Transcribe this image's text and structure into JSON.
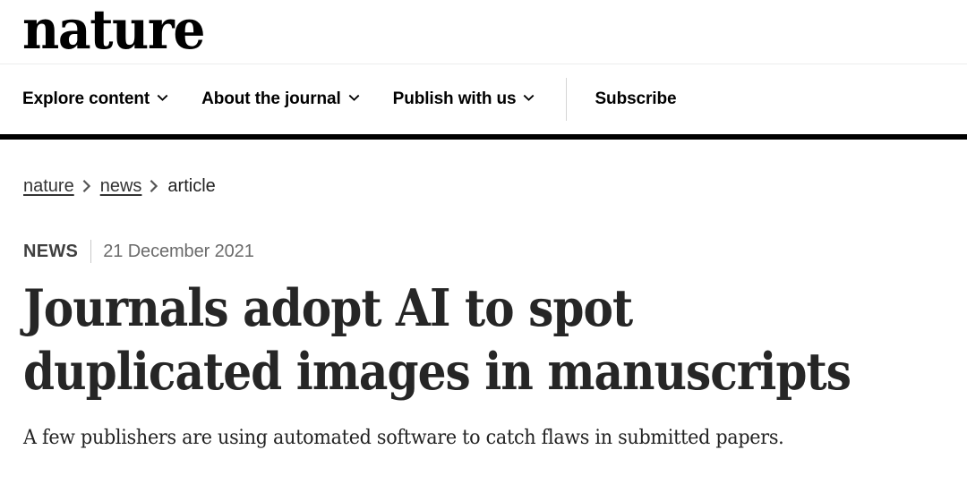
{
  "site": {
    "logo_text": "nature"
  },
  "nav": {
    "items": [
      {
        "label": "Explore content",
        "has_chevron": true,
        "icon": "chevron-down-icon"
      },
      {
        "label": "About the journal",
        "has_chevron": true,
        "icon": "chevron-down-icon"
      },
      {
        "label": "Publish with us",
        "has_chevron": true,
        "icon": "chevron-down-icon"
      },
      {
        "label": "Subscribe",
        "has_chevron": false,
        "icon": ""
      }
    ]
  },
  "breadcrumb": {
    "separator_icon": "chevron-right-icon",
    "items": [
      {
        "label": "nature",
        "is_link": true
      },
      {
        "label": "news",
        "is_link": true
      },
      {
        "label": "article",
        "is_link": false
      }
    ]
  },
  "article": {
    "kicker": "NEWS",
    "date": "21 December 2021",
    "title_line_1": "Journals adopt AI to spot",
    "title_line_2": "duplicated images in manuscripts",
    "standfirst": "A few publishers are using automated software to catch flaws in submitted papers."
  },
  "colors": {
    "background": "#ffffff",
    "text_primary": "#262626",
    "text_muted": "#6b6b6b",
    "rule_heavy": "#000000",
    "rule_light": "#eceded"
  }
}
